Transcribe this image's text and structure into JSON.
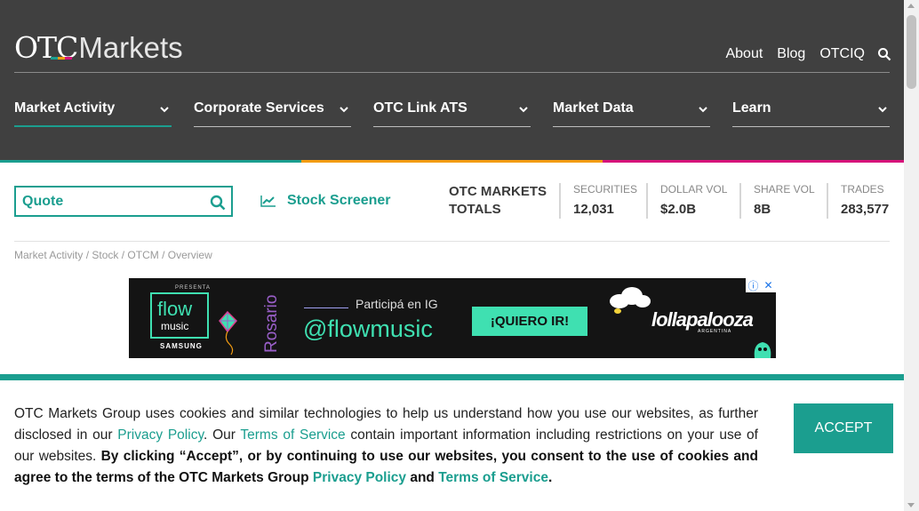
{
  "header": {
    "logo_part1": "OTC",
    "logo_part2": "Markets",
    "top_links": [
      "About",
      "Blog",
      "OTCIQ"
    ],
    "search_icon": "search-icon",
    "nav": [
      {
        "label": "Market Activity"
      },
      {
        "label": "Corporate Services"
      },
      {
        "label": "OTC Link ATS"
      },
      {
        "label": "Market Data"
      },
      {
        "label": "Learn"
      }
    ]
  },
  "quote": {
    "placeholder": "Quote"
  },
  "screener": {
    "label": "Stock Screener"
  },
  "totals": {
    "title_line1": "OTC MARKETS",
    "title_line2": "TOTALS",
    "stats": [
      {
        "label": "SECURITIES",
        "value": "12,031"
      },
      {
        "label": "DOLLAR VOL",
        "value": "$2.0B"
      },
      {
        "label": "SHARE VOL",
        "value": "8B"
      },
      {
        "label": "TRADES",
        "value": "283,577"
      }
    ]
  },
  "breadcrumb": {
    "items": [
      "Market Activity",
      "Stock",
      "OTCM",
      "Overview"
    ]
  },
  "ad": {
    "presenta": "PRESENTA",
    "brand": "flow",
    "brand_sub": "music",
    "sponsor": "SAMSUNG",
    "city": "Rosario",
    "tagline": "Participá en IG",
    "handle": "@flowmusic",
    "cta": "¡QUIERO IR!",
    "festival": "lollapalooza",
    "festival_sub": "ARGENTINA",
    "adchoice_info": "ⓘ",
    "adchoice_close": "✕"
  },
  "cookie": {
    "text_1": "OTC Markets Group uses cookies and similar technologies to help us understand how you use our websites, as further disclosed in our ",
    "link_privacy": "Privacy Policy",
    "text_2": ". Our ",
    "link_terms": "Terms of Service",
    "text_3": " contain important information including restrictions on your use of our websites. ",
    "bold_1": "By clicking “Accept”, or by continuing to use our websites, you consent to the use of cookies and agree to the terms of the OTC Markets Group ",
    "bold_and": " and ",
    "bold_end": ".",
    "accept_label": "ACCEPT"
  },
  "colors": {
    "accent": "#1b9e8f",
    "header_bg": "#404040",
    "bar_teal": "#1b9e8f",
    "bar_orange": "#f39c12",
    "bar_magenta": "#d6127a"
  }
}
